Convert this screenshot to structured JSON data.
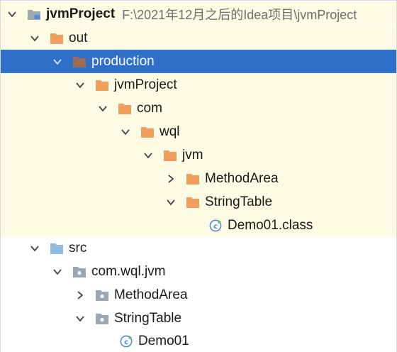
{
  "colors": {
    "excluded_bg": "#fdfbe3",
    "selected_bg": "#2f6fc8",
    "folder_orange": "#f0a05c",
    "folder_selected": "#9c6b5a",
    "folder_gray": "#9ea7b0",
    "folder_blue": "#8fbbe3",
    "class_green": "#5fb757"
  },
  "tree": {
    "root": {
      "label": "jvmProject",
      "path": "F:\\2021年12月之后的Idea项目\\jvmProject",
      "icon": "module-folder-icon",
      "expanded": true
    },
    "nodes": [
      {
        "label": "out",
        "icon": "folder-orange-icon",
        "arrow": "expanded"
      },
      {
        "label": "production",
        "icon": "folder-orange-icon",
        "arrow": "expanded",
        "selected": true
      },
      {
        "label": "jvmProject",
        "icon": "folder-orange-icon",
        "arrow": "expanded"
      },
      {
        "label": "com",
        "icon": "folder-orange-icon",
        "arrow": "expanded"
      },
      {
        "label": "wql",
        "icon": "folder-orange-icon",
        "arrow": "expanded"
      },
      {
        "label": "jvm",
        "icon": "folder-orange-icon",
        "arrow": "expanded"
      },
      {
        "label": "MethodArea",
        "icon": "folder-orange-icon",
        "arrow": "collapsed"
      },
      {
        "label": "StringTable",
        "icon": "folder-orange-icon",
        "arrow": "expanded"
      },
      {
        "label": "Demo01.class",
        "icon": "class-file-icon",
        "arrow": "none"
      },
      {
        "label": "src",
        "icon": "source-folder-icon",
        "arrow": "expanded"
      },
      {
        "label": "com.wql.jvm",
        "icon": "package-icon",
        "arrow": "expanded"
      },
      {
        "label": "MethodArea",
        "icon": "package-icon",
        "arrow": "collapsed"
      },
      {
        "label": "StringTable",
        "icon": "package-icon",
        "arrow": "expanded"
      },
      {
        "label": "Demo01",
        "icon": "java-class-icon",
        "arrow": "none"
      }
    ]
  }
}
